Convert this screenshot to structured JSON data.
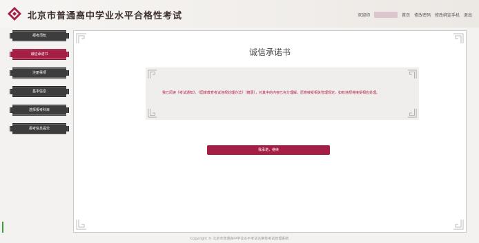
{
  "header": {
    "site_title": "北京市普通高中学业水平合格性考试",
    "welcome": "欢迎你",
    "links": [
      "首页",
      "修改密码",
      "修改绑定手机",
      "退出"
    ]
  },
  "sidebar": {
    "items": [
      {
        "label": "报考须知",
        "active": false
      },
      {
        "label": "诚信承诺书",
        "active": true
      },
      {
        "label": "注册事项",
        "active": false
      },
      {
        "label": "基本信息",
        "active": false
      },
      {
        "label": "选择报考科目",
        "active": false
      },
      {
        "label": "报考信息提交",
        "active": false
      }
    ]
  },
  "main": {
    "title": "诚信承诺书",
    "notice": "我已阅读《考试通知》、《国家教育考试违规处理办法》（摘录），对其中的内容已充分理解，愿意接受相关管理规定，如有违规将接受相应处理。",
    "confirm_button": "我承诺，继续"
  },
  "footer": {
    "copyright": "Copyright © 北京市普通高中学业水平考试合格性考试管理系统"
  },
  "colors": {
    "accent": "#a51e45",
    "sidebar_button": "#3d3d3d",
    "notice_text": "#b01a3e"
  },
  "icons": {
    "logo": "diamond-logo-icon",
    "corner": "fret-corner-icon"
  }
}
